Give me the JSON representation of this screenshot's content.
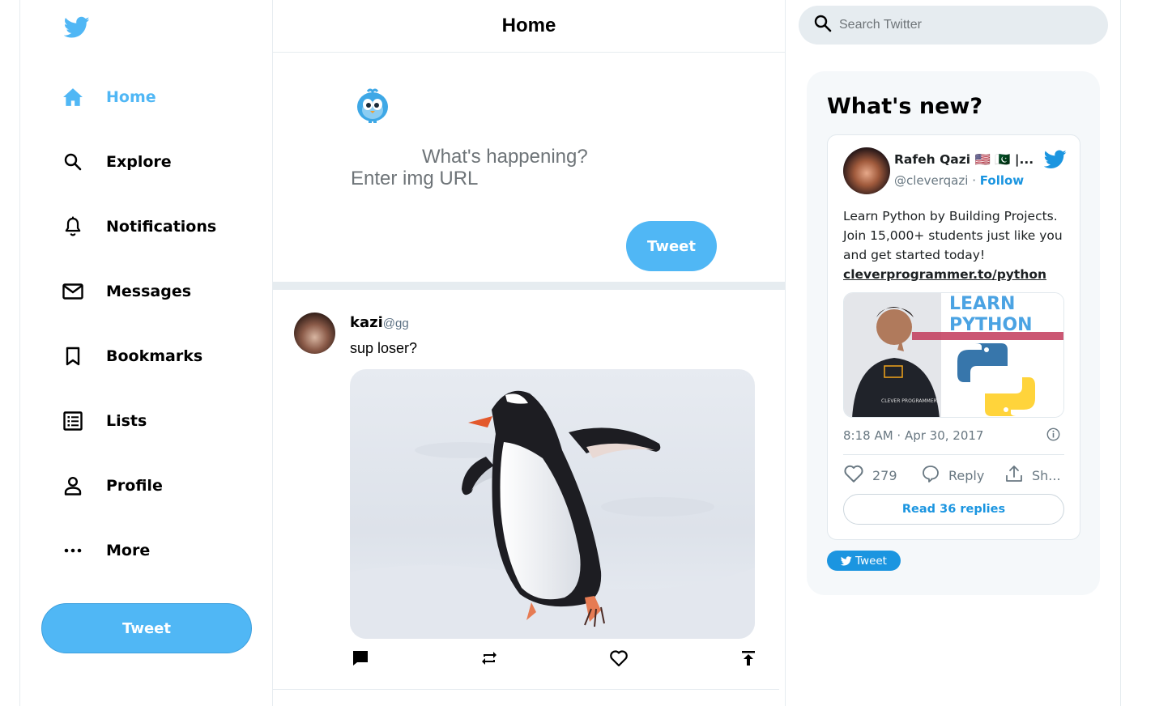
{
  "sidebar": {
    "logo_icon": "twitter-bird-icon",
    "items": [
      {
        "label": "Home",
        "icon": "home-icon",
        "active": true
      },
      {
        "label": "Explore",
        "icon": "search-icon"
      },
      {
        "label": "Notifications",
        "icon": "bell-icon"
      },
      {
        "label": "Messages",
        "icon": "mail-icon"
      },
      {
        "label": "Bookmarks",
        "icon": "bookmark-icon"
      },
      {
        "label": "Lists",
        "icon": "list-icon"
      },
      {
        "label": "Profile",
        "icon": "person-icon"
      },
      {
        "label": "More",
        "icon": "more-icon"
      }
    ],
    "tweet_label": "Tweet"
  },
  "feed": {
    "title": "Home",
    "composer": {
      "placeholder": "What's happening?",
      "img_placeholder": "Enter img URL",
      "tweet_label": "Tweet"
    },
    "post": {
      "name": "kazi",
      "handle": "@gg",
      "text": "sup loser?",
      "image": "penguin-on-snow-photo",
      "actions": [
        "comment-icon",
        "retweet-icon",
        "heart-icon",
        "share-icon"
      ]
    }
  },
  "right": {
    "search_placeholder": "Search Twitter",
    "widget_title": "What's new?",
    "embed": {
      "name": "Rafeh Qazi 🇺🇸 🇵🇰 |...",
      "handle": "@cleverqazi",
      "separator": "·",
      "follow": "Follow",
      "text": "Learn Python by Building Projects. Join 15,000+ students just like you and get started today!",
      "link": "cleverprogrammer.to/python",
      "media_title_1": "LEARN",
      "media_title_2": "PYTHON",
      "shirt_text": "CLEVER PROGRAMMER",
      "timestamp": "8:18 AM · Apr 30, 2017",
      "likes": "279",
      "reply_label": "Reply",
      "share_label": "Sh...",
      "read_replies": "Read 36 replies"
    },
    "share_tweet_label": "Tweet"
  },
  "colors": {
    "brand": "#50b7f5",
    "twitter_blue": "#1b95e0",
    "border": "#e6ecf0"
  }
}
